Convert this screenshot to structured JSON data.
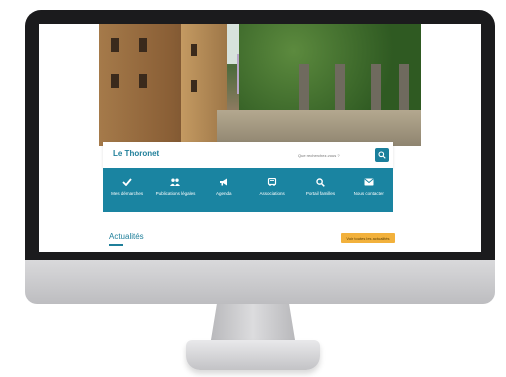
{
  "site": {
    "title": "Le Thoronet",
    "search_placeholder": "Que recherchez-vous ?",
    "accent_color": "#1a84a1",
    "button_color": "#f2b13c"
  },
  "nav": {
    "items": [
      {
        "label": "Mes démarches",
        "icon": "check-icon"
      },
      {
        "label": "Publications légales",
        "icon": "users-icon"
      },
      {
        "label": "Agenda",
        "icon": "megaphone-icon"
      },
      {
        "label": "Associations",
        "icon": "book-icon"
      },
      {
        "label": "Portail familles",
        "icon": "search-icon"
      },
      {
        "label": "Nous contacter",
        "icon": "envelope-icon"
      }
    ]
  },
  "news": {
    "title": "Actualités",
    "button_label": "Voir toutes les actualités"
  }
}
